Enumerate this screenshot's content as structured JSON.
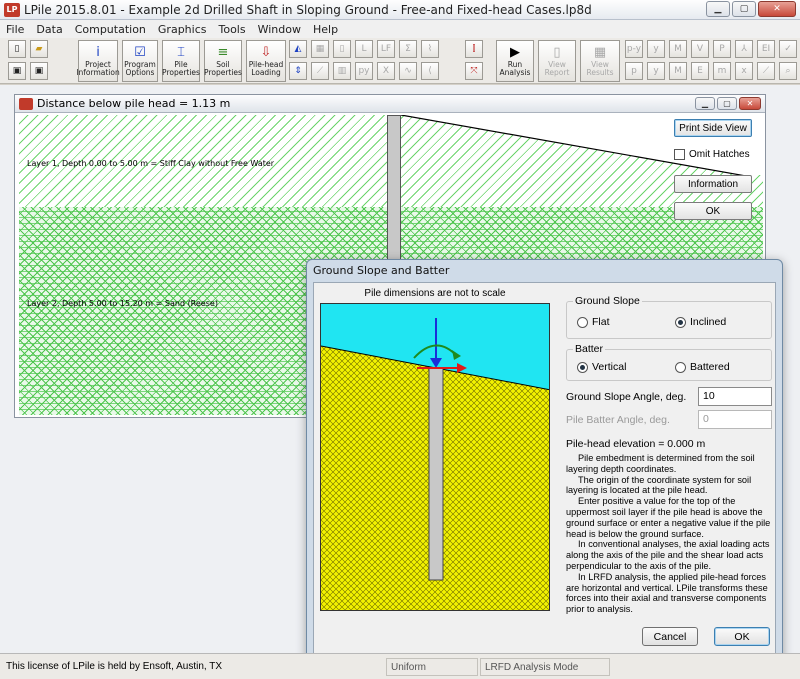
{
  "window": {
    "title": "LPile 2015.8.01 - Example 2d Drilled Shaft in Sloping Ground - Free-and Fixed-head Cases.lp8d",
    "app_icon": "LP"
  },
  "menu": [
    "File",
    "Data",
    "Computation",
    "Graphics",
    "Tools",
    "Window",
    "Help"
  ],
  "toolbar": {
    "big_buttons": [
      {
        "name": "project-information-button",
        "label": "Project\nInformation",
        "icon": "i",
        "color": "#1a3fc2"
      },
      {
        "name": "program-options-button",
        "label": "Program\nOptions",
        "icon": "☑",
        "color": "#1a3fc2"
      },
      {
        "name": "pile-properties-button",
        "label": "Pile\nProperties",
        "icon": "⌶",
        "color": "#1a3fc2"
      },
      {
        "name": "soil-properties-button",
        "label": "Soil\nProperties",
        "icon": "≡",
        "color": "#3a8a2a"
      },
      {
        "name": "pile-head-loading-button",
        "label": "Pile-head\nLoading",
        "icon": "⇩",
        "color": "#c02a2a"
      },
      {
        "name": "run-analysis-button",
        "label": "Run\nAnalysis",
        "icon": "▶",
        "color": "#000000"
      },
      {
        "name": "view-report-button",
        "label": "View\nReport",
        "icon": "▯",
        "color": "#a8a8a8"
      },
      {
        "name": "view-results-button",
        "label": "View\nResults",
        "icon": "▦",
        "color": "#a8a8a8"
      }
    ],
    "small_glyphs_row1": [
      "LF",
      "Σ",
      "p-y",
      "M"
    ],
    "small_glyphs_row2": [
      "EI"
    ]
  },
  "child_window": {
    "title": "Distance below pile head = 1.13 m",
    "layer1_label": "Layer 1, Depth 0.00 to 5.00 m = Stiff Clay without Free Water",
    "layer2_label": "Layer 2, Depth 5.00 to 15.20 m = Sand (Reese)",
    "print_button": "Print Side View",
    "omit_hatches": "Omit Hatches",
    "information_button": "Information",
    "ok_button": "OK"
  },
  "dialog": {
    "title": "Ground Slope and Batter",
    "caption": "Pile dimensions are not to scale",
    "ground_slope": {
      "title": "Ground Slope",
      "options": [
        "Flat",
        "Inclined"
      ],
      "selected": "Inclined"
    },
    "batter": {
      "title": "Batter",
      "options": [
        "Vertical",
        "Battered"
      ],
      "selected": "Vertical"
    },
    "slope_angle_label": "Ground Slope Angle, deg.",
    "slope_angle_value": "10",
    "batter_angle_label": "Pile Batter Angle, deg.",
    "batter_angle_value": "0",
    "elevation_text": "Pile-head elevation = 0.000 m",
    "help": [
      "Pile embedment is determined from the soil layering depth coordinates.",
      "The origin of the coordinate system for soil layering is located at the pile head.",
      "Enter positive a value for the top of the uppermost soil layer if the pile head is above the ground surface or enter a negative value if the pile head is below the ground surface.",
      "In conventional analyses, the axial loading acts along the axis of the pile and the shear load acts perpendicular to the axis of the pile.",
      "In LRFD analysis, the applied pile-head forces are horizontal and vertical. LPile transforms these forces into their axial and transverse components prior to analysis."
    ],
    "cancel": "Cancel",
    "ok": "OK"
  },
  "status": {
    "license": "This license of LPile is held by Ensoft, Austin, TX",
    "seg1": "Uniform",
    "seg2": "LRFD Analysis Mode"
  },
  "colors": {
    "sky": "#20e5f2",
    "soil": "#f2f200",
    "pile": "#c8c8c8",
    "arrow_blue": "#1a2fd8",
    "arrow_red": "#e01a1a",
    "moment_green": "#1e8a1e"
  }
}
